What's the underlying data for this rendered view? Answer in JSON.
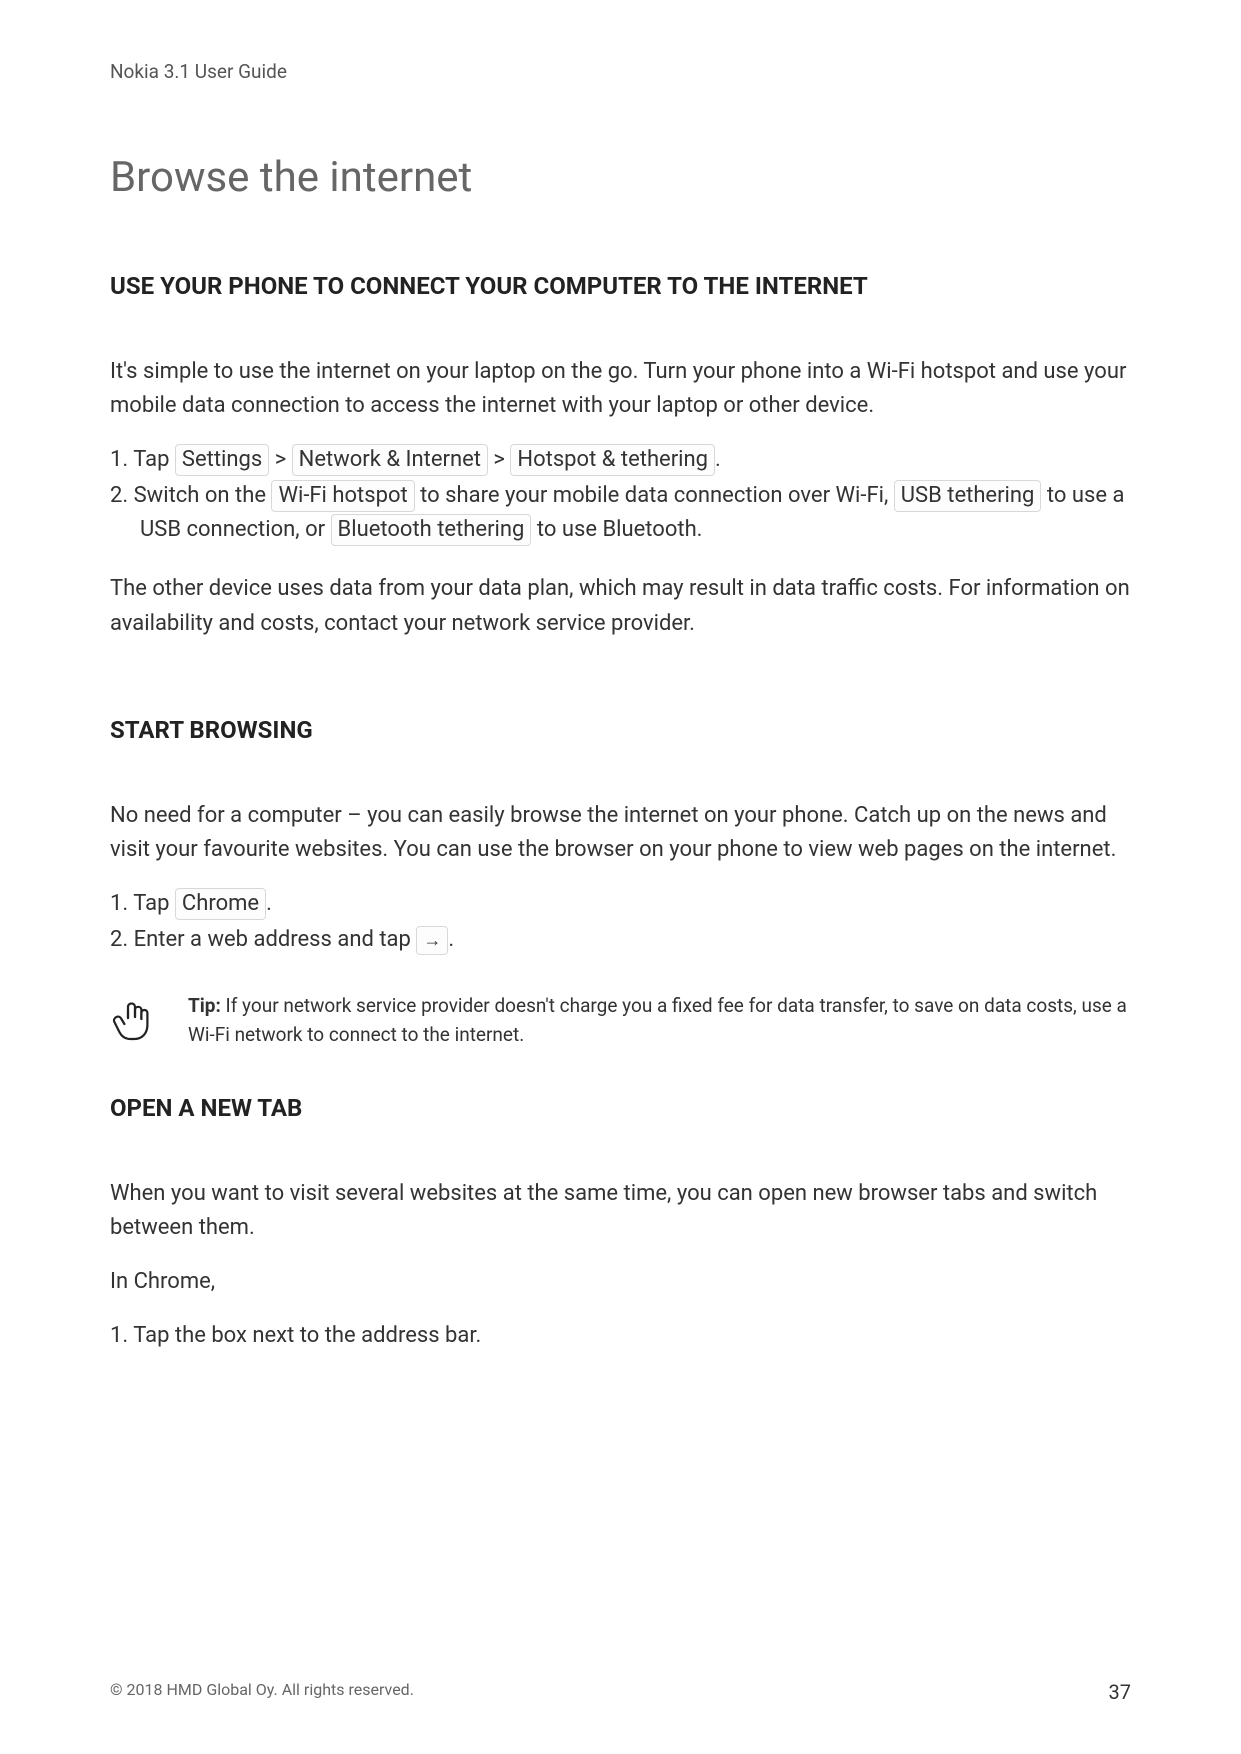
{
  "header": {
    "title": "Nokia 3.1 User Guide"
  },
  "page_title": "Browse the internet",
  "section1": {
    "heading": "USE YOUR PHONE TO CONNECT YOUR COMPUTER TO THE INTERNET",
    "intro": "It's simple to use the internet on your laptop on the go. Turn your phone into a Wi-Fi hotspot and use your mobile data connection to access the internet with your laptop or other device.",
    "step1_pre": "1. Tap ",
    "step1_k1": "Settings",
    "step1_sep1": " > ",
    "step1_k2": "Network & Internet",
    "step1_sep2": " > ",
    "step1_k3": "Hotspot & tethering",
    "step1_post": ".",
    "step2_pre": "2. Switch on the ",
    "step2_k1": "Wi-Fi hotspot",
    "step2_mid1": " to share your mobile data connection over Wi-Fi, ",
    "step2_k2": "USB tethering",
    "step2_mid2": " to use a USB connection, or ",
    "step2_k3": "Bluetooth tethering",
    "step2_post": " to use Bluetooth.",
    "outro": "The other device uses data from your data plan, which may result in data traffic costs. For information on availability and costs, contact your network service provider."
  },
  "section2": {
    "heading": "START BROWSING",
    "intro": "No need for a computer – you can easily browse the internet on your phone. Catch up on the news and visit your favourite websites. You can use the browser on your phone to view web pages on the internet.",
    "step1_pre": "1. Tap ",
    "step1_k1": "Chrome",
    "step1_post": ".",
    "step2_pre": "2. Enter a web address and tap ",
    "step2_arrow": "→",
    "step2_post": ".",
    "tip_label": "Tip:",
    "tip_text": " If your network service provider doesn't charge you a fixed fee for data transfer, to save on data costs, use a Wi-Fi network to connect to the internet."
  },
  "section3": {
    "heading": "OPEN A NEW TAB",
    "intro": "When you want to visit several websites at the same time, you can open new browser tabs and switch between them.",
    "line2": "In Chrome,",
    "step1": "1. Tap the box next to the address bar."
  },
  "footer": {
    "copyright": "© 2018 HMD Global Oy. All rights reserved.",
    "page_number": "37"
  }
}
